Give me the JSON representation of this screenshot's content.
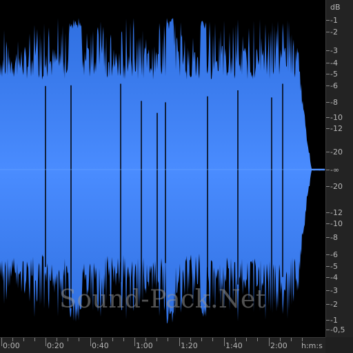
{
  "colors": {
    "waveform": "#4a8cff",
    "background": "#000000",
    "ruler_text": "#b8b8b8"
  },
  "watermark": "Sound-Pack.Net",
  "db_scale": {
    "unit": "dB",
    "labels": [
      "-1",
      "-2",
      "-3",
      "-4",
      "-5",
      "-6",
      "-8",
      "-10",
      "-12",
      "-20",
      "-∞",
      "-20",
      "-12",
      "-10",
      "-8",
      "-6",
      "-5",
      "-4",
      "-3",
      "-2",
      "-1",
      "-0,5"
    ]
  },
  "time_scale": {
    "unit": "h:m:s",
    "labels": [
      "0:00",
      "0:20",
      "0:40",
      "1:00",
      "1:20",
      "1:40",
      "2:00"
    ]
  }
}
